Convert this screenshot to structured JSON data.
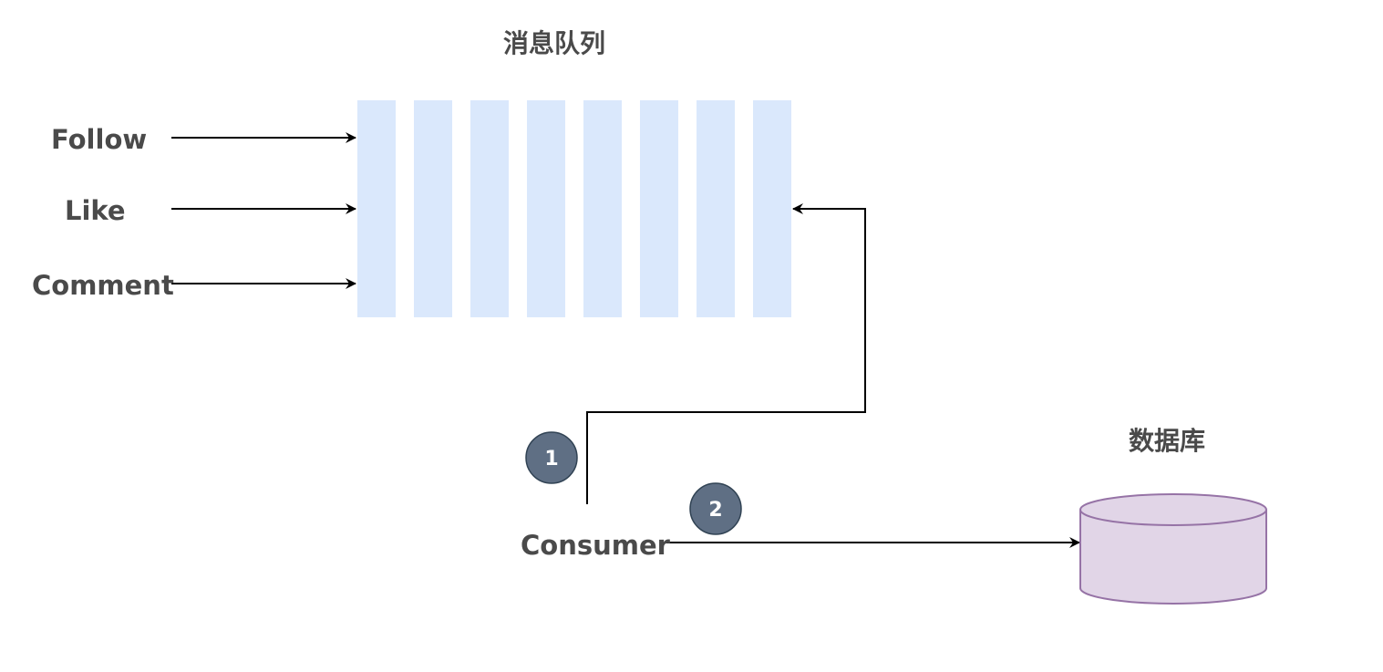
{
  "queue": {
    "title": "消息队列",
    "slot_count": 8
  },
  "producers": [
    {
      "label": "Follow"
    },
    {
      "label": "Like"
    },
    {
      "label": "Comment"
    }
  ],
  "consumer": {
    "label": "Consumer"
  },
  "database": {
    "title": "数据库"
  },
  "steps": [
    {
      "number": "1"
    },
    {
      "number": "2"
    }
  ],
  "colors": {
    "queue_slot": "#dae8fc",
    "database_fill": "#e1d5e7",
    "database_stroke": "#9673a6",
    "badge_fill": "#5f6f84",
    "text": "#4a4a4a"
  }
}
